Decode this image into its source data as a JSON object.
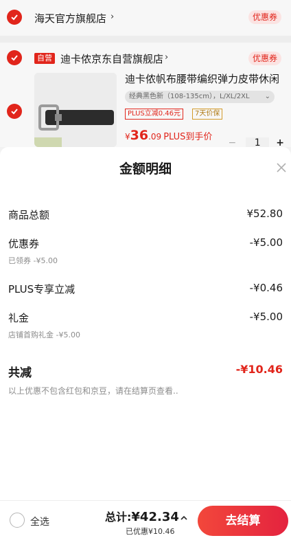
{
  "cart": {
    "store1": {
      "name": "海天官方旗舰店",
      "chevron": "›",
      "coupon": "优惠券"
    },
    "store2": {
      "badge": "自营",
      "name": "迪卡侬京东自营旗舰店",
      "chevron": "›",
      "coupon": "优惠券",
      "product": {
        "title": "迪卡侬帆布腰带编织弹力皮带休闲",
        "variant": "经典黑色新（108-135cm），L/XL/2XL",
        "variant_caret": "⌄",
        "tags": [
          "PLUS立减0.46元",
          "7天价保"
        ],
        "price_currency": "¥",
        "price_int": "36",
        "price_dec": ".09",
        "price_suffix": "PLUS到手价",
        "qty_minus": "−",
        "qty": "1",
        "qty_plus": "+"
      }
    }
  },
  "sheet": {
    "title": "金额明细",
    "rows": [
      {
        "label": "商品总额",
        "value": "¥52.80",
        "sub": ""
      },
      {
        "label": "优惠券",
        "value": "-¥5.00",
        "sub": "已领券 -¥5.00"
      },
      {
        "label": "PLUS专享立减",
        "value": "-¥0.46",
        "sub": ""
      },
      {
        "label": "礼金",
        "value": "-¥5.00",
        "sub": "店铺首购礼金 -¥5.00"
      }
    ],
    "total": {
      "label": "共减",
      "value": "-¥10.46"
    },
    "note": "以上优惠不包含红包和京豆，请在结算页查看.."
  },
  "bottom_bar": {
    "select_all": "全选",
    "total_label": "总计:",
    "total_amount": "¥42.34",
    "saved": "已优惠¥10.46",
    "checkout": "去结算"
  },
  "colors": {
    "accent": "#e1251b",
    "checkout_start": "#f2473b",
    "checkout_end": "#e4233f"
  }
}
